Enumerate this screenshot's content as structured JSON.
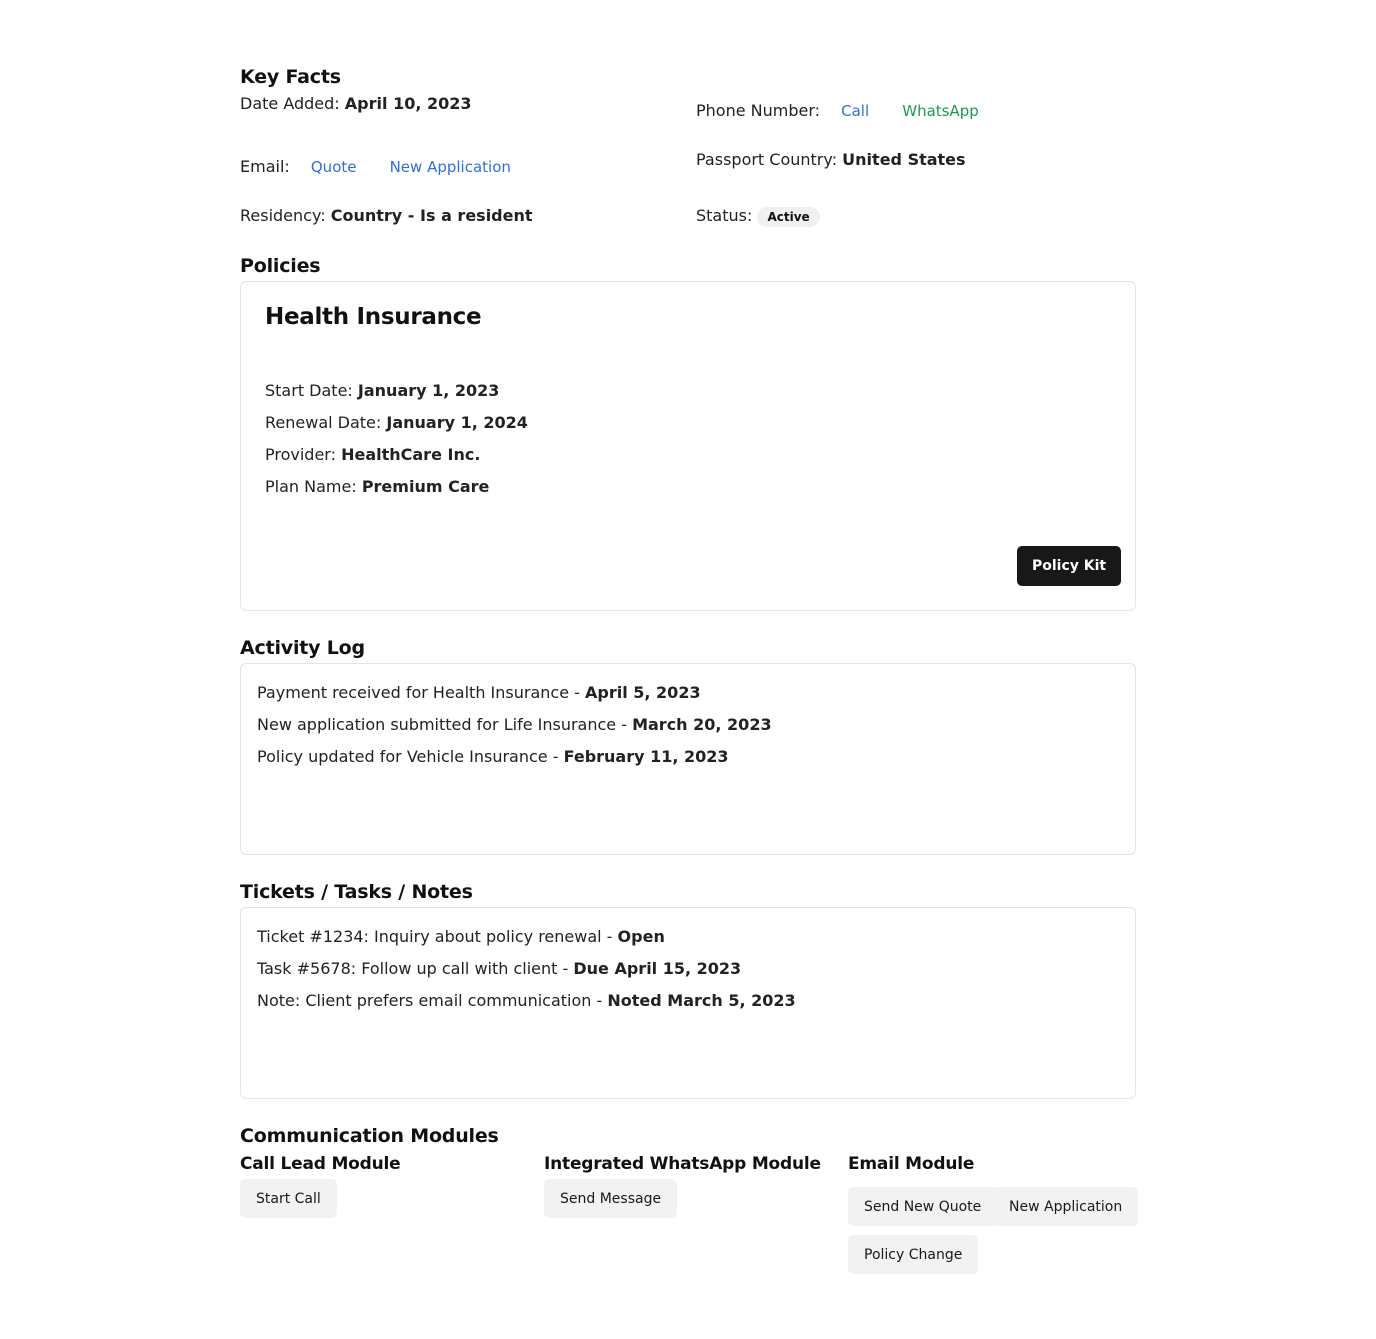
{
  "key_facts": {
    "title": "Key Facts",
    "date_added_label": "Date Added:",
    "date_added_value": "April 10, 2023",
    "phone_label": "Phone Number:",
    "call_link": "Call",
    "whatsapp_link": "WhatsApp",
    "email_label": "Email:",
    "quote_link": "Quote",
    "new_application_link": "New Application",
    "passport_label": "Passport Country:",
    "passport_value": "United States",
    "residency_label": "Residency:",
    "residency_value": "Country - Is a resident",
    "status_label": "Status:",
    "status_value": "Active"
  },
  "policies": {
    "title": "Policies",
    "card": {
      "name": "Health Insurance",
      "start_label": "Start Date:",
      "start_value": "January 1, 2023",
      "renewal_label": "Renewal Date:",
      "renewal_value": "January 1, 2024",
      "provider_label": "Provider:",
      "provider_value": "HealthCare Inc.",
      "plan_label": "Plan Name:",
      "plan_value": "Premium Care",
      "button": "Policy Kit"
    }
  },
  "activity_log": {
    "title": "Activity Log",
    "items": [
      {
        "text": "Payment received for Health Insurance - ",
        "date": "April 5, 2023"
      },
      {
        "text": "New application submitted for Life Insurance - ",
        "date": "March 20, 2023"
      },
      {
        "text": "Policy updated for Vehicle Insurance - ",
        "date": "February 11, 2023"
      }
    ]
  },
  "tickets": {
    "title": "Tickets / Tasks / Notes",
    "items": [
      {
        "text": "Ticket #1234: Inquiry about policy renewal - ",
        "status": "Open"
      },
      {
        "text": "Task #5678: Follow up call with client - ",
        "status": "Due April 15, 2023"
      },
      {
        "text": "Note: Client prefers email communication - ",
        "status": "Noted March 5, 2023"
      }
    ]
  },
  "communication": {
    "title": "Communication Modules",
    "call_module": {
      "title": "Call Lead Module",
      "button": "Start Call"
    },
    "whatsapp_module": {
      "title": "Integrated WhatsApp Module",
      "button": "Send Message"
    },
    "email_module": {
      "title": "Email Module",
      "send_quote_button": "Send New Quote",
      "new_application_button": "New Application",
      "policy_change_button": "Policy Change"
    }
  },
  "colors": {
    "link_blue": "#2f6fd6",
    "link_green": "#1f9a4a",
    "dark_button": "#18181b",
    "light_button": "#f2f2f3"
  }
}
